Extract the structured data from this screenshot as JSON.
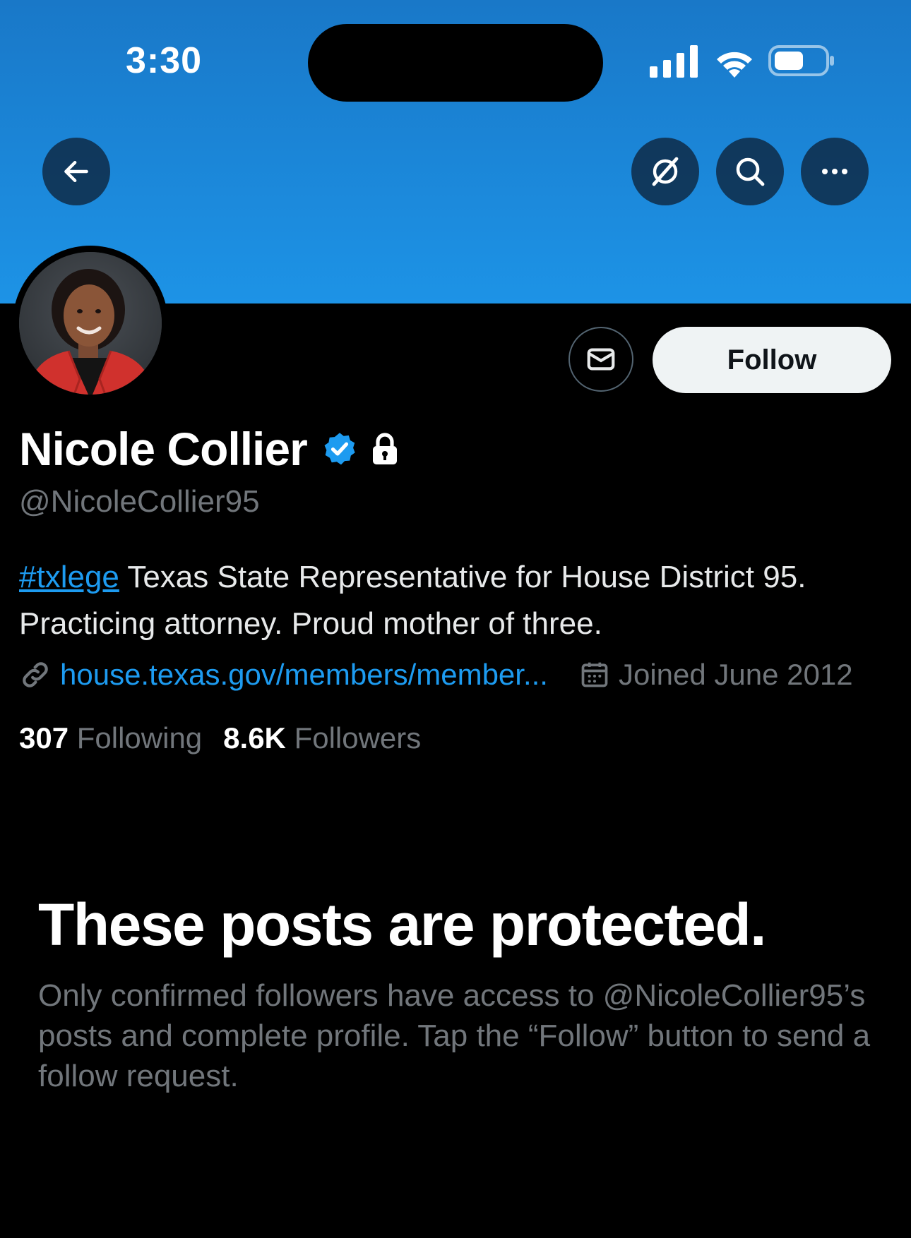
{
  "status_bar": {
    "time": "3:30"
  },
  "nav": {
    "back_icon": "back-arrow-icon",
    "grok_icon": "grok-icon",
    "search_icon": "search-icon",
    "more_icon": "more-icon"
  },
  "profile": {
    "display_name": "Nicole Collier",
    "handle": "@NicoleCollier95",
    "bio": {
      "hashtag": "#txlege",
      "text": " Texas State Representative for House District 95. Practicing attorney. Proud mother of three."
    },
    "website": "house.texas.gov/members/member...",
    "joined": "Joined June 2012",
    "following_count": "307",
    "following_label": "Following",
    "followers_count": "8.6K",
    "followers_label": "Followers"
  },
  "actions": {
    "follow_label": "Follow"
  },
  "protected": {
    "title": "These posts are protected.",
    "message": "Only confirmed followers have access to @NicoleCollier95’s posts and complete profile. Tap the “Follow” button to send a follow request."
  },
  "colors": {
    "accent": "#1d9bf0",
    "banner_top": "#1978c8",
    "banner_bottom": "#1d93e6",
    "background": "#000000",
    "muted_text": "#71767b"
  }
}
